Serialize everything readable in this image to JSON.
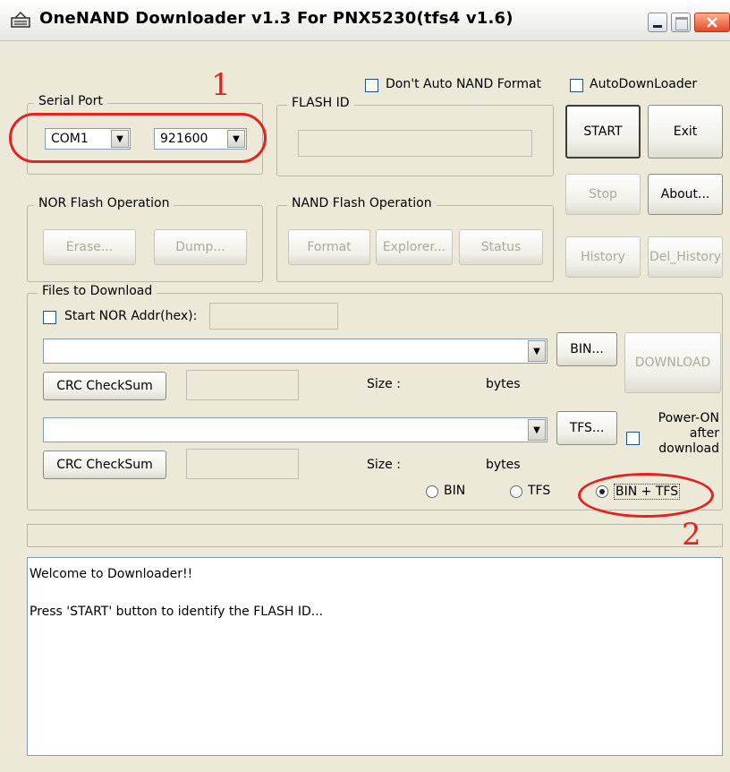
{
  "window": {
    "title": "OneNAND Downloader v1.3 For PNX5230(tfs4 v1.6)"
  },
  "options": {
    "dont_auto_nand_format": "Don't Auto NAND Format",
    "auto_downloader": "AutoDownLoader"
  },
  "serial_port": {
    "label": "Serial Port",
    "port_value": "COM1",
    "baud_value": "921600"
  },
  "flash_id": {
    "label": "FLASH ID",
    "value": ""
  },
  "buttons": {
    "start": "START",
    "exit": "Exit",
    "stop": "Stop",
    "about": "About...",
    "history": "History",
    "del_history": "Del_History"
  },
  "nor_flash": {
    "label": "NOR Flash Operation",
    "erase": "Erase...",
    "dump": "Dump..."
  },
  "nand_flash": {
    "label": "NAND Flash Operation",
    "format": "Format",
    "explorer": "Explorer...",
    "status": "Status"
  },
  "files": {
    "label": "Files to Download",
    "start_nor_addr_label": "Start NOR Addr(hex):",
    "bin_button": "BIN...",
    "tfs_button": "TFS...",
    "download_button": "DOWNLOAD",
    "crc_label_1": "CRC CheckSum",
    "crc_label_2": "CRC CheckSum",
    "size_label_1": "Size :",
    "size_label_2": "Size :",
    "bytes_label_1": "bytes",
    "bytes_label_2": "bytes",
    "power_on_after_download": [
      "Power-ON",
      "after",
      "download"
    ]
  },
  "mode": {
    "bin": "BIN",
    "tfs": "TFS",
    "bin_tfs": "BIN + TFS",
    "selected": "bin_tfs"
  },
  "annotations": {
    "marker_1": "1",
    "marker_2": "2",
    "accent_color": "#e32222"
  },
  "log": {
    "lines": [
      "Welcome to Downloader!!",
      "Press 'START' button to identify the FLASH ID..."
    ]
  }
}
